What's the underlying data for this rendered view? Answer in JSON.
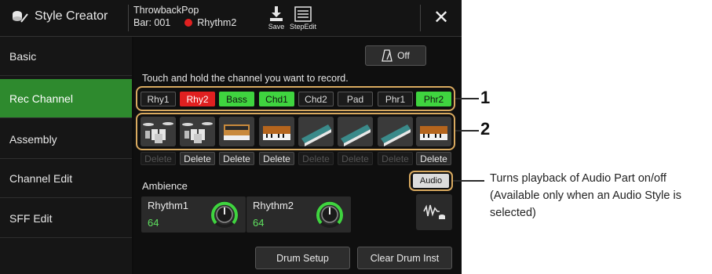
{
  "header": {
    "app_title": "Style Creator",
    "style_name": "ThrowbackPop",
    "bar": "Bar: 001",
    "rec_status": "Rhythm2",
    "save_label": "Save",
    "stepedit_label": "StepEdit",
    "close_label": "✕",
    "colors": {
      "rec_dot": "#e02020"
    }
  },
  "sidebar": {
    "items": [
      {
        "label": "Basic",
        "active": false
      },
      {
        "label": "Rec Channel",
        "active": true
      },
      {
        "label": "Assembly",
        "active": false
      },
      {
        "label": "Channel Edit",
        "active": false
      },
      {
        "label": "SFF Edit",
        "active": false
      }
    ],
    "accent": "#2e8a2e"
  },
  "metronome": {
    "label": "Off",
    "icon": "metronome-icon"
  },
  "instruction": "Touch and hold the channel you want to record.",
  "channels": [
    {
      "label": "Rhy1",
      "state": "off",
      "instrument": "drum-kit",
      "delete_enabled": false
    },
    {
      "label": "Rhy2",
      "state": "recording",
      "instrument": "drum-kit",
      "delete_enabled": true
    },
    {
      "label": "Bass",
      "state": "on",
      "instrument": "synth-keyboard",
      "delete_enabled": true
    },
    {
      "label": "Chd1",
      "state": "on",
      "instrument": "keyboard",
      "delete_enabled": true
    },
    {
      "label": "Chd2",
      "state": "off",
      "instrument": "synth-keyboard",
      "delete_enabled": false
    },
    {
      "label": "Pad",
      "state": "off",
      "instrument": "synth-keyboard",
      "delete_enabled": false
    },
    {
      "label": "Phr1",
      "state": "off",
      "instrument": "synth-keyboard",
      "delete_enabled": false
    },
    {
      "label": "Phr2",
      "state": "on",
      "instrument": "keyboard",
      "delete_enabled": true
    }
  ],
  "delete_label": "Delete",
  "ambience": {
    "label": "Ambience",
    "controls": [
      {
        "name": "Rhythm1",
        "value": "64"
      },
      {
        "name": "Rhythm2",
        "value": "64"
      }
    ]
  },
  "audio_button": {
    "label": "Audio",
    "icon": "audio-waveform-icon"
  },
  "footer": {
    "drum_setup_label": "Drum Setup",
    "clear_drum_label": "Clear Drum Inst"
  },
  "annotations": {
    "callout_1": "1",
    "callout_2": "2",
    "audio_note": "Turns playback of Audio Part on/off (Available only when an Audio Style is selected)"
  },
  "colors": {
    "channel_on": "#3fd43f",
    "channel_recording": "#e02020",
    "highlight_frame": "#d9aa60",
    "ambience_value": "#5fe05f"
  }
}
